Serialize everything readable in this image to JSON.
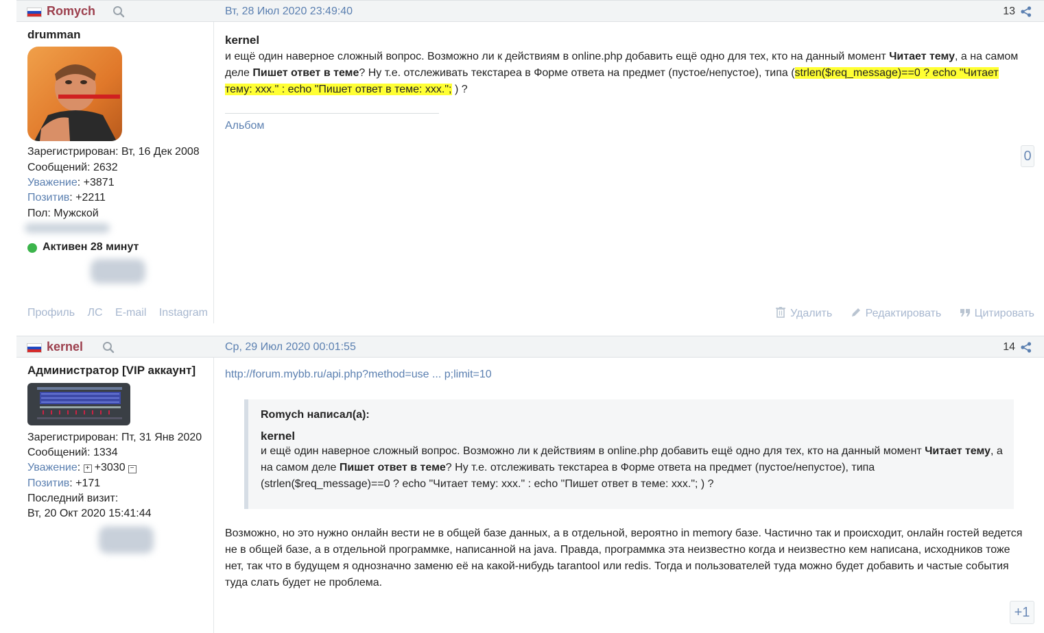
{
  "colors": {
    "accent_link": "#5a7fb0",
    "author": "#9c3f4d",
    "highlight": "#ffff33",
    "online": "#3cb44b"
  },
  "post1": {
    "author": "Romych",
    "date": "Вт, 28 Июл 2020 23:49:40",
    "number": "13",
    "user_title": "drumman",
    "registered": "Зарегистрирован: Вт, 16 Дек 2008",
    "messages": "Сообщений: 2632",
    "respect_label": "Уважение",
    "respect_value": ": +3871",
    "positive_label": "Позитив",
    "positive_value": ": +2211",
    "gender": "Пол: Мужской",
    "active": "Активен 28 минут",
    "links": [
      "Профиль",
      "ЛС",
      "E-mail",
      "Instagram"
    ],
    "body_title": "kernel",
    "body_p1": "и ещё один наверное сложный вопрос. Возможно ли к действиям в online.php добавить ещё одно для тех, кто на данный момент ",
    "body_b1": "Читает тему",
    "body_p2": ", а на самом",
    "body_p3": "деле ",
    "body_b2": "Пишет ответ в теме",
    "body_p4": "? Ну т.е. отслеживать текстареа в Форме ответа на предмет (пустое/непустое), типа (",
    "body_hl1": "strlen($req_message)==0 ? echo \"Читает",
    "body_hl2": "тему: xxx.\" : echo \"Пишет ответ в теме: xxx.\";",
    "body_p5": " ) ?",
    "album": "Альбом",
    "rating": "0",
    "actions": {
      "delete": "Удалить",
      "edit": "Редактировать",
      "quote": "Цитировать"
    }
  },
  "post2": {
    "author": "kernel",
    "date": "Ср, 29 Июл 2020 00:01:55",
    "number": "14",
    "user_title": "Администратор [VIP аккаунт]",
    "registered": "Зарегистрирован: Пт, 31 Янв 2020",
    "messages": "Сообщений: 1334",
    "respect_label": "Уважение",
    "respect_value": ": ",
    "respect_num": "+3030",
    "positive_label": "Позитив",
    "positive_value": ": +171",
    "last_visit_label": "Последний визит:",
    "last_visit": "Вт, 20 Окт 2020 15:41:44",
    "link": "http://forum.mybb.ru/api.php?method=use ... p;limit=10",
    "quote_author": "Romych написал(а):",
    "quote_title": "kernel",
    "quote_l1a": "и ещё один наверное сложный вопрос. Возможно ли к действиям в online.php добавить ещё одно для тех, кто на данный момент ",
    "quote_l1b": "Читает тему",
    "quote_l1c": ", а",
    "quote_l2a": "на самом деле ",
    "quote_l2b": "Пишет ответ в теме",
    "quote_l2c": "? Ну т.е. отслеживать текстареа в Форме ответа на предмет (пустое/непустое), типа",
    "quote_l3": "(strlen($req_message)==0 ? echo \"Читает тему: xxx.\" : echo \"Пишет ответ в теме: xxx.\"; ) ?",
    "answer": "Возможно, но это нужно онлайн вести не в общей базе данных, а в отдельной, вероятно in memory базе. Частично так и происходит, онлайн гостей ведется не в общей базе, а в отдельной программке, написанной на java. Правда, программка эта неизвестно когда и неизвестно кем написана, исходников тоже нет, так что в будущем я однозначно заменю её на какой-нибудь tarantool или redis. Тогда и пользователей туда можно будет добавить и частые события туда слать будет не проблема.",
    "rating": "+1"
  }
}
